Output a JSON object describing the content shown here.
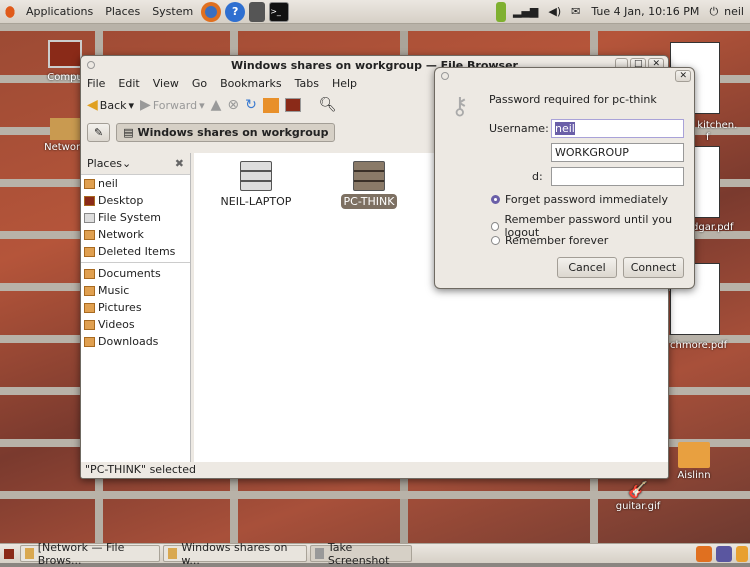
{
  "top_panel": {
    "menus": [
      "Applications",
      "Places",
      "System"
    ],
    "clock": "Tue  4 Jan, 10:16 PM",
    "user": "neil",
    "launchers": [
      "firefox-icon",
      "help-icon",
      "calculator-icon",
      "terminal-icon"
    ]
  },
  "desktop": {
    "icons": [
      {
        "label": "Compu"
      },
      {
        "label": "Network"
      },
      {
        "label": "r kitchen."
      },
      {
        "label": "f"
      },
      {
        "label": "dgar.pdf"
      },
      {
        "label": "chmore.pdf"
      },
      {
        "label": "Aislinn"
      },
      {
        "label": "guitar.gif"
      }
    ]
  },
  "file_browser": {
    "title": "Windows shares on workgroup — File Browser",
    "menu": [
      "File",
      "Edit",
      "View",
      "Go",
      "Bookmarks",
      "Tabs",
      "Help"
    ],
    "toolbar": {
      "back": "Back",
      "forward": "Forward"
    },
    "location": "Windows shares on workgroup",
    "places_label": "Places",
    "places": [
      "neil",
      "Desktop",
      "File System",
      "Network",
      "Deleted Items"
    ],
    "bookmarks": [
      "Documents",
      "Music",
      "Pictures",
      "Videos",
      "Downloads"
    ],
    "items": [
      {
        "label": "NEIL-LAPTOP",
        "selected": false
      },
      {
        "label": "PC-THINK",
        "selected": true
      }
    ],
    "status": "\"PC-THINK\" selected"
  },
  "dialog": {
    "heading": "Password required for pc-think",
    "username_label": "Username:",
    "username": "neil",
    "domain": "WORKGROUP",
    "password_label": "d:",
    "password": "",
    "options": [
      {
        "label": "Forget password immediately",
        "checked": true
      },
      {
        "label": "Remember password until you logout",
        "checked": false
      },
      {
        "label": "Remember forever",
        "checked": false
      }
    ],
    "cancel": "Cancel",
    "connect": "Connect"
  },
  "taskbar": {
    "tasks": [
      "[Network — File Brows...",
      "Windows shares on w...",
      "Take Screenshot"
    ]
  },
  "colors": {
    "accent": "#6a5fa8",
    "selection": "#7d7062"
  }
}
